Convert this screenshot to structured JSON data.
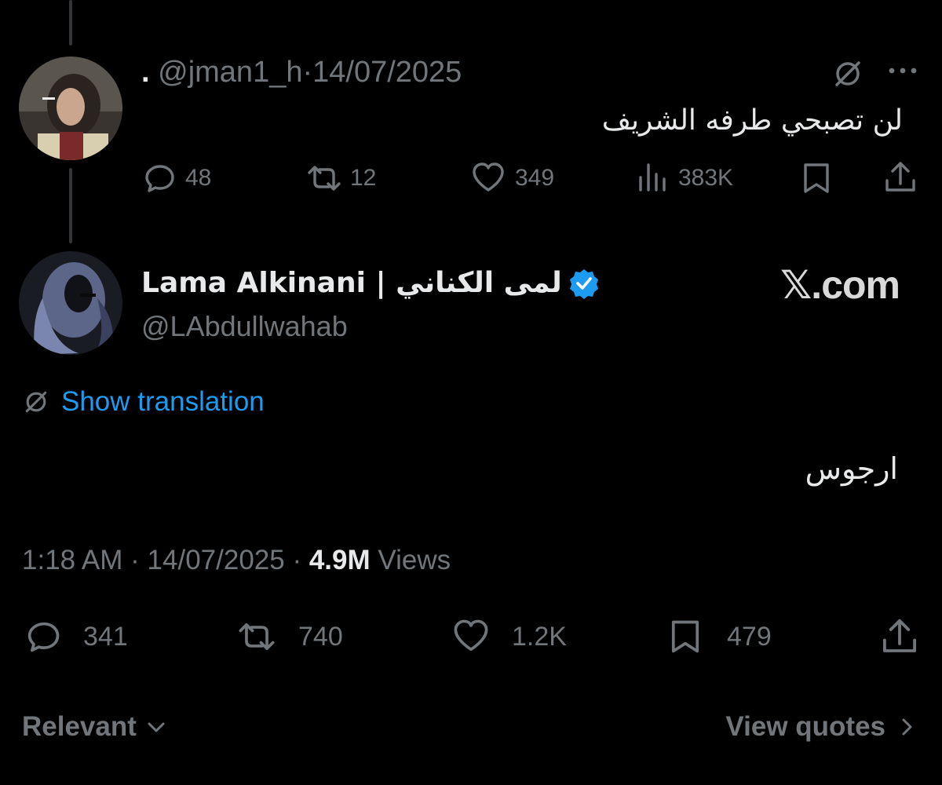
{
  "reply": {
    "display_name": ".",
    "handle": "@jman1_h",
    "separator": "·",
    "date": "14/07/2025",
    "text": "لن تصبحي طرفه الشريف",
    "stats": {
      "replies": "48",
      "reposts": "12",
      "likes": "349",
      "views": "383K"
    }
  },
  "main": {
    "display_name": "Lama Alkinani | لمى الكناني",
    "handle": "@LAbdullwahab",
    "verified": true,
    "watermark": "𝕏.com",
    "show_translation": "Show translation",
    "text": "ارجوس",
    "time": "1:18 AM",
    "separator": "·",
    "date": "14/07/2025",
    "views_count": "4.9M",
    "views_label": "Views",
    "stats": {
      "replies": "341",
      "reposts": "740",
      "likes": "1.2K",
      "bookmarks": "479"
    }
  },
  "footer": {
    "sort_label": "Relevant",
    "view_quotes": "View quotes"
  },
  "colors": {
    "background": "#000000",
    "text": "#e7e9ea",
    "muted": "#71767b",
    "link": "#1d9bf0",
    "verified": "#1d9bf0"
  }
}
